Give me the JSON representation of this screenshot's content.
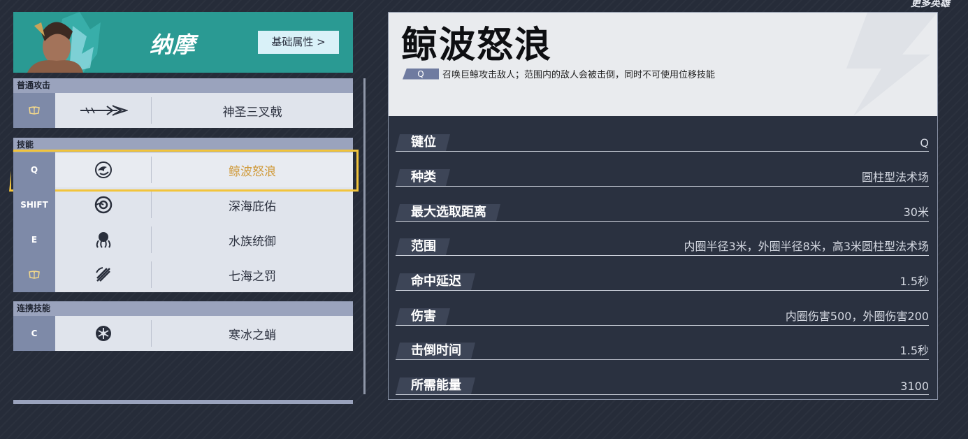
{
  "corner_link": "更多英雄",
  "hero": {
    "name": "纳摩",
    "attr_button": "基础属性 >"
  },
  "sections": {
    "basic": {
      "title": "普通攻击",
      "rows": [
        {
          "key": "",
          "name": "神圣三叉戟"
        }
      ]
    },
    "skills": {
      "title": "技能",
      "rows": [
        {
          "key": "Q",
          "name": "鲸波怒浪"
        },
        {
          "key": "SHIFT",
          "name": "深海庇佑"
        },
        {
          "key": "E",
          "name": "水族统御"
        },
        {
          "key": "",
          "name": "七海之罚"
        }
      ]
    },
    "combo": {
      "title": "连携技能",
      "rows": [
        {
          "key": "C",
          "name": "寒冰之蛸"
        }
      ]
    }
  },
  "detail": {
    "title": "鲸波怒浪",
    "key_tag": "Q",
    "description": "召唤巨鲸攻击敌人；范围内的敌人会被击倒，同时不可使用位移技能",
    "stats": [
      {
        "label": "键位",
        "value": "Q"
      },
      {
        "label": "种类",
        "value": "圆柱型法术场"
      },
      {
        "label": "最大选取距离",
        "value": "30米"
      },
      {
        "label": "范围",
        "value": "内圈半径3米，外圈半径8米，高3米圆柱型法术场"
      },
      {
        "label": "命中延迟",
        "value": "1.5秒"
      },
      {
        "label": "伤害",
        "value": "内圈伤害500，外圈伤害200"
      },
      {
        "label": "击倒时间",
        "value": "1.5秒"
      },
      {
        "label": "所需能量",
        "value": "3100"
      }
    ]
  },
  "colors": {
    "accent_teal": "#2a9a93",
    "selected_gold": "#f2c43b",
    "selected_text": "#d09a3a"
  }
}
